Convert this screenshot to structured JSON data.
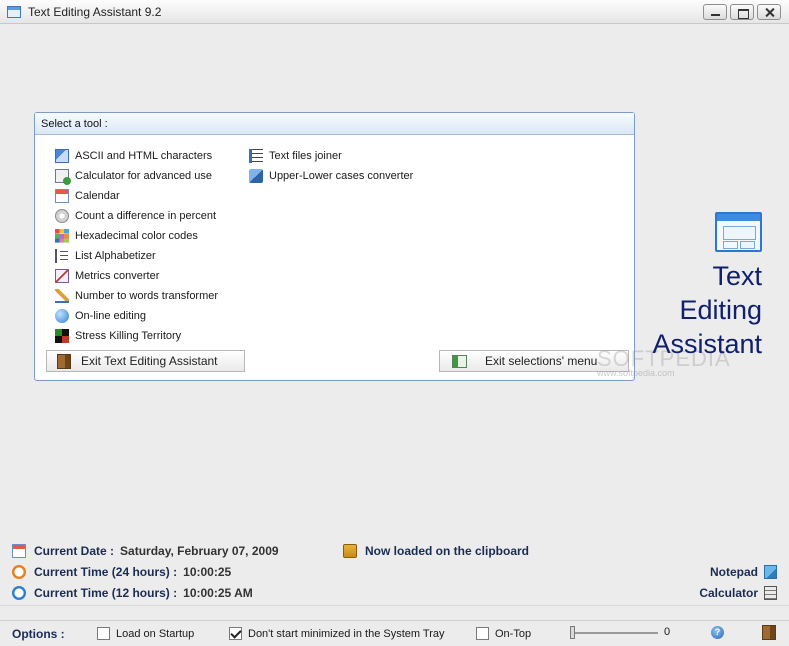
{
  "window": {
    "title": "Text Editing Assistant 9.2"
  },
  "panel": {
    "header": "Select a tool :",
    "tools_col1": [
      {
        "label": "ASCII and HTML characters",
        "icon": "ascii-icon"
      },
      {
        "label": "Calculator for advanced use",
        "icon": "calculator-icon"
      },
      {
        "label": "Calendar",
        "icon": "calendar-icon"
      },
      {
        "label": "Count a difference in percent",
        "icon": "percent-icon"
      },
      {
        "label": "Hexadecimal color codes",
        "icon": "color-grid-icon"
      },
      {
        "label": "List Alphabetizer",
        "icon": "list-icon"
      },
      {
        "label": "Metrics converter",
        "icon": "metrics-icon"
      },
      {
        "label": "Number to words transformer",
        "icon": "pencil-icon"
      },
      {
        "label": "On-line editing",
        "icon": "globe-icon"
      },
      {
        "label": "Stress Killing Territory",
        "icon": "stress-icon"
      }
    ],
    "tools_col2": [
      {
        "label": "Text files joiner",
        "icon": "joiner-icon"
      },
      {
        "label": "Upper-Lower cases converter",
        "icon": "case-icon"
      }
    ],
    "exit_app_label": "Exit Text Editing Assistant",
    "exit_menu_label": "Exit selections' menu"
  },
  "brand": {
    "line1": "Text",
    "line2": "Editing",
    "line3": "Assistant",
    "watermark": "SOFTPEDIA",
    "watermark_sub": "www.softpedia.com"
  },
  "status": {
    "date_label": "Current Date :",
    "date_value": "Saturday, February 07, 2009",
    "time24_label": "Current Time (24 hours) :",
    "time24_value": "10:00:25",
    "time12_label": "Current Time (12 hours) :",
    "time12_value": "10:00:25 AM",
    "clipboard_label": "Now loaded on the clipboard",
    "notepad_label": "Notepad",
    "calculator_label": "Calculator"
  },
  "options": {
    "label": "Options :",
    "load_on_startup": {
      "label": "Load on Startup",
      "checked": false
    },
    "dont_minimize": {
      "label": "Don't start minimized in the System Tray",
      "checked": true
    },
    "on_top": {
      "label": "On-Top",
      "checked": false
    },
    "slider_value": "0"
  }
}
